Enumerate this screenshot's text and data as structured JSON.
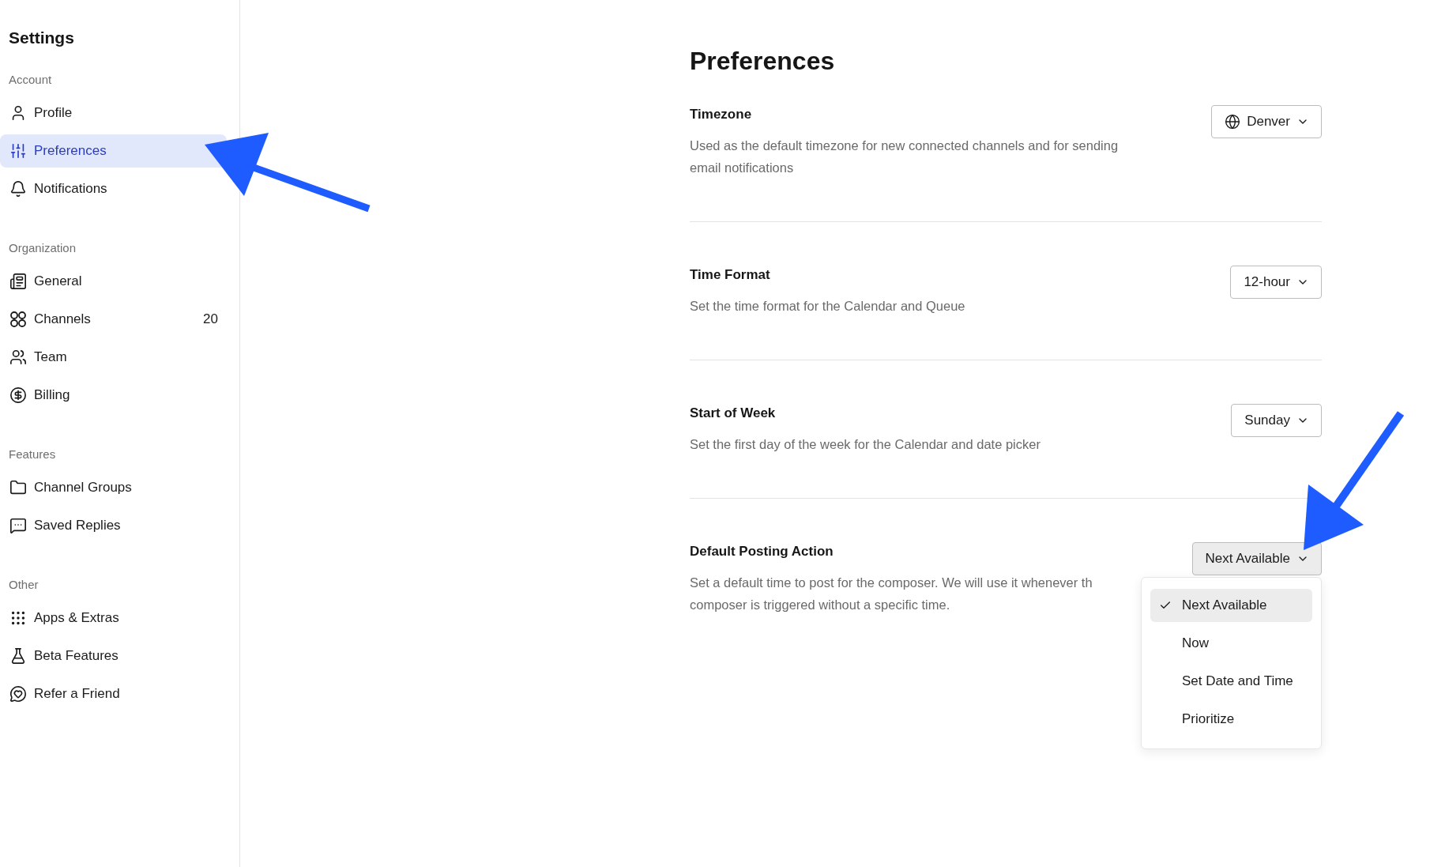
{
  "sidebar": {
    "title": "Settings",
    "sections": [
      {
        "heading": "Account",
        "items": [
          {
            "label": "Profile",
            "selected": false
          },
          {
            "label": "Preferences",
            "selected": true
          },
          {
            "label": "Notifications",
            "selected": false
          }
        ]
      },
      {
        "heading": "Organization",
        "items": [
          {
            "label": "General",
            "selected": false
          },
          {
            "label": "Channels",
            "count": "20",
            "selected": false
          },
          {
            "label": "Team",
            "selected": false
          },
          {
            "label": "Billing",
            "selected": false
          }
        ]
      },
      {
        "heading": "Features",
        "items": [
          {
            "label": "Channel Groups",
            "selected": false
          },
          {
            "label": "Saved Replies",
            "selected": false
          }
        ]
      },
      {
        "heading": "Other",
        "items": [
          {
            "label": "Apps & Extras",
            "selected": false
          },
          {
            "label": "Beta Features",
            "selected": false
          },
          {
            "label": "Refer a Friend",
            "selected": false
          }
        ]
      }
    ]
  },
  "page": {
    "title": "Preferences",
    "settings": [
      {
        "label": "Timezone",
        "description_lines": [
          "Used as the default timezone for new connected channels and for sending",
          "email notifications"
        ],
        "dropdown": {
          "value": "Denver",
          "expanded": false
        }
      },
      {
        "label": "Time Format",
        "description_lines": [
          "Set the time format for the Calendar and Queue"
        ],
        "dropdown": {
          "value": "12-hour",
          "expanded": false
        }
      },
      {
        "label": "Start of Week",
        "description_lines": [
          "Set the first day of the week for the Calendar and date picker"
        ],
        "dropdown": {
          "value": "Sunday",
          "expanded": false
        }
      },
      {
        "label": "Default Posting Action",
        "description_lines": [
          "Set a default time to post for the composer. We will use it whenever th",
          "composer is triggered without a specific time."
        ],
        "dropdown": {
          "value": "Next Available",
          "expanded": true,
          "options": [
            {
              "label": "Next Available",
              "selected": true
            },
            {
              "label": "Now",
              "selected": false
            },
            {
              "label": "Set Date and Time",
              "selected": false
            },
            {
              "label": "Prioritize",
              "selected": false
            }
          ]
        }
      }
    ]
  }
}
